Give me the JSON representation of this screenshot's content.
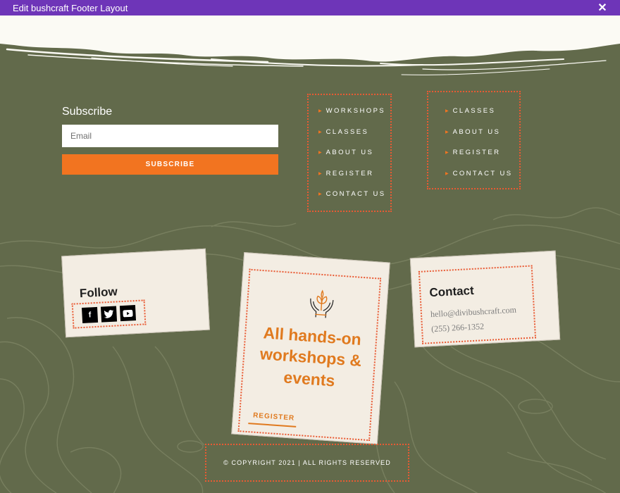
{
  "window": {
    "title": "Edit bushcraft Footer Layout",
    "close_glyph": "✕"
  },
  "subscribe": {
    "title": "Subscribe",
    "email_placeholder": "Email",
    "button_label": "SUBSCRIBE"
  },
  "menu_1": [
    "WORKSHOPS",
    "CLASSES",
    "ABOUT US",
    "REGISTER",
    "CONTACT US"
  ],
  "menu_2": [
    "CLASSES",
    "ABOUT US",
    "REGISTER",
    "CONTACT US"
  ],
  "follow": {
    "title": "Follow",
    "icons": [
      "facebook-icon",
      "twitter-icon",
      "youtube-icon"
    ]
  },
  "promo": {
    "icon": "hands-plant-icon",
    "title": "All hands-on workshops & events",
    "link_label": "REGISTER"
  },
  "contact": {
    "title": "Contact",
    "email": "hello@divibushcraft.com",
    "phone": "(255) 266-1352"
  },
  "copyright": "© COPYRIGHT 2021 | ALL RIGHTS RESERVED",
  "colors": {
    "title_bar": "#6e35b8",
    "background": "#626a4b",
    "accent_orange": "#f27420",
    "dotted_outline": "#e95a33",
    "card": "#f3ede3"
  }
}
